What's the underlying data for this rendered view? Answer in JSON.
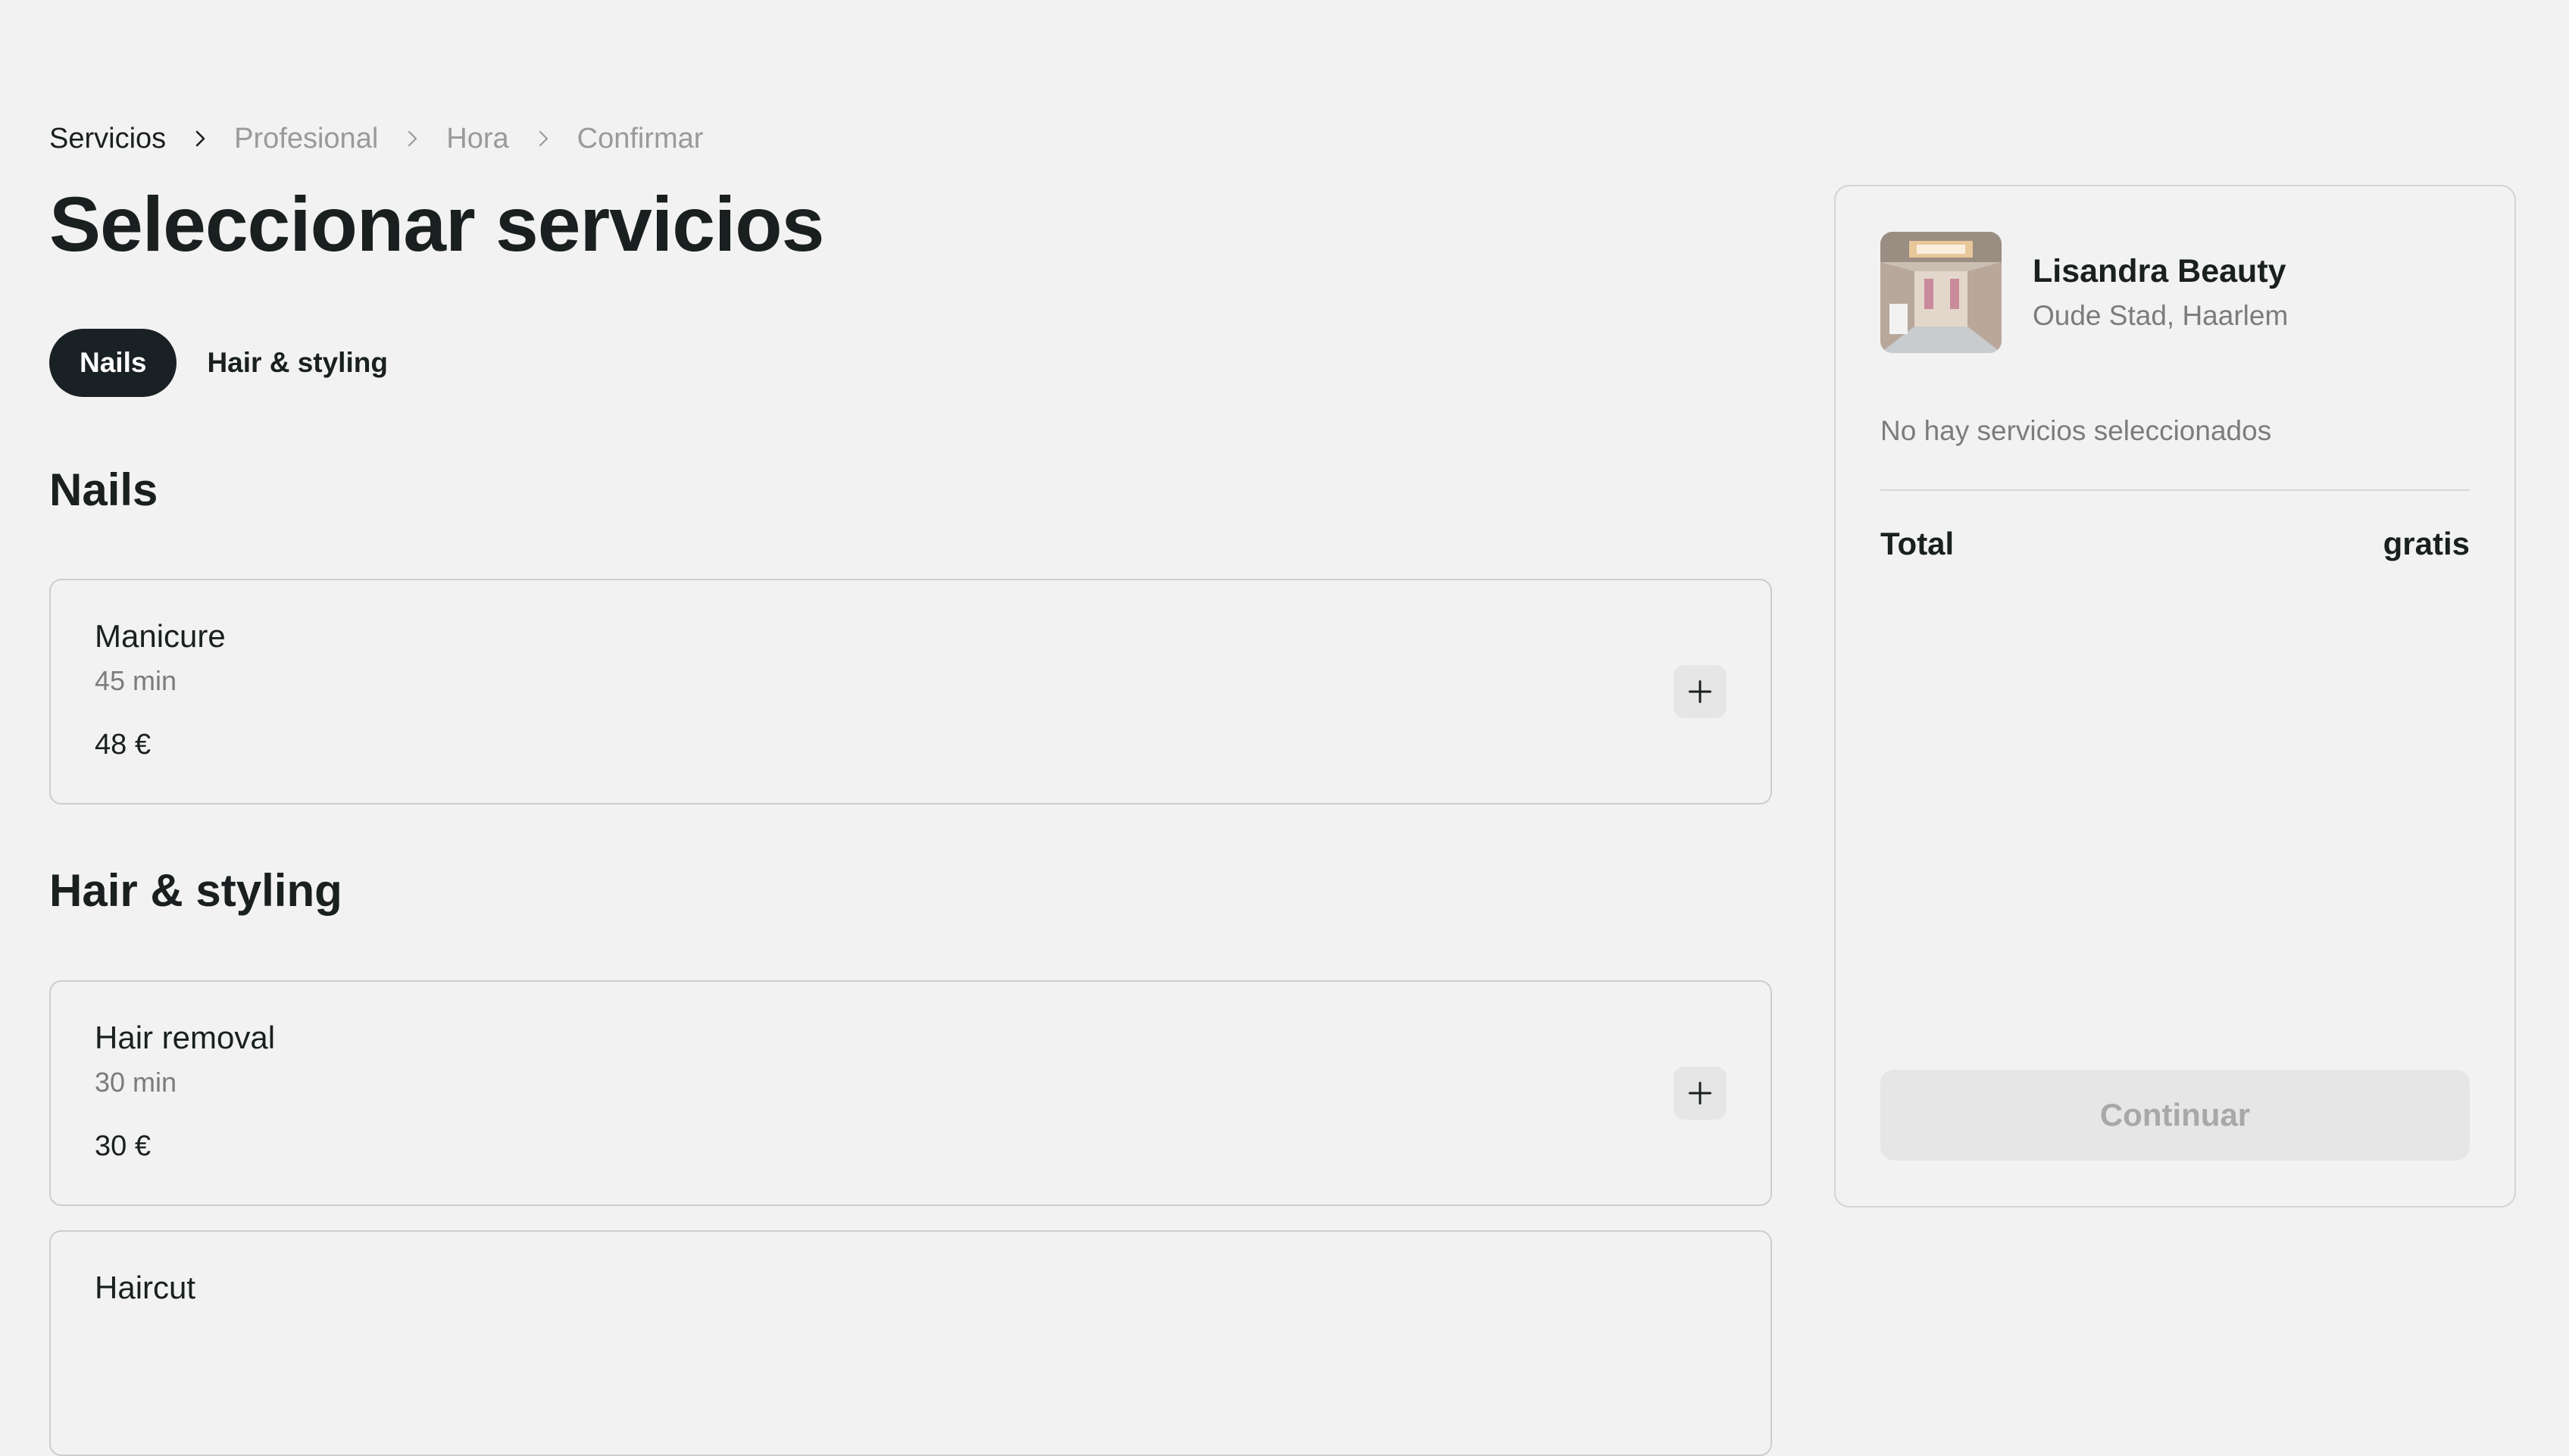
{
  "breadcrumb": {
    "steps": [
      "Servicios",
      "Profesional",
      "Hora",
      "Confirmar"
    ]
  },
  "page_title": "Seleccionar servicios",
  "tabs": [
    {
      "label": "Nails",
      "active": true
    },
    {
      "label": "Hair & styling",
      "active": false
    }
  ],
  "sections": [
    {
      "title": "Nails",
      "services": [
        {
          "name": "Manicure",
          "duration": "45 min",
          "price": "48 €"
        }
      ]
    },
    {
      "title": "Hair & styling",
      "services": [
        {
          "name": "Hair removal",
          "duration": "30 min",
          "price": "30 €"
        },
        {
          "name": "Haircut"
        }
      ]
    }
  ],
  "icons": {
    "breadcrumb_separator": "chevron-right-icon",
    "add": "plus-icon"
  },
  "summary": {
    "salon_name": "Lisandra Beauty",
    "salon_location": "Oude Stad, Haarlem",
    "empty_text": "No hay servicios seleccionados",
    "total_label": "Total",
    "total_value": "gratis",
    "continue_label": "Continuar"
  },
  "colors": {
    "background": "#f2f2f2",
    "active_tab": "#1a2124",
    "text": "#1a1f1f",
    "muted_text": "#7c7c7c",
    "disabled_button": "#e6e6e6"
  }
}
